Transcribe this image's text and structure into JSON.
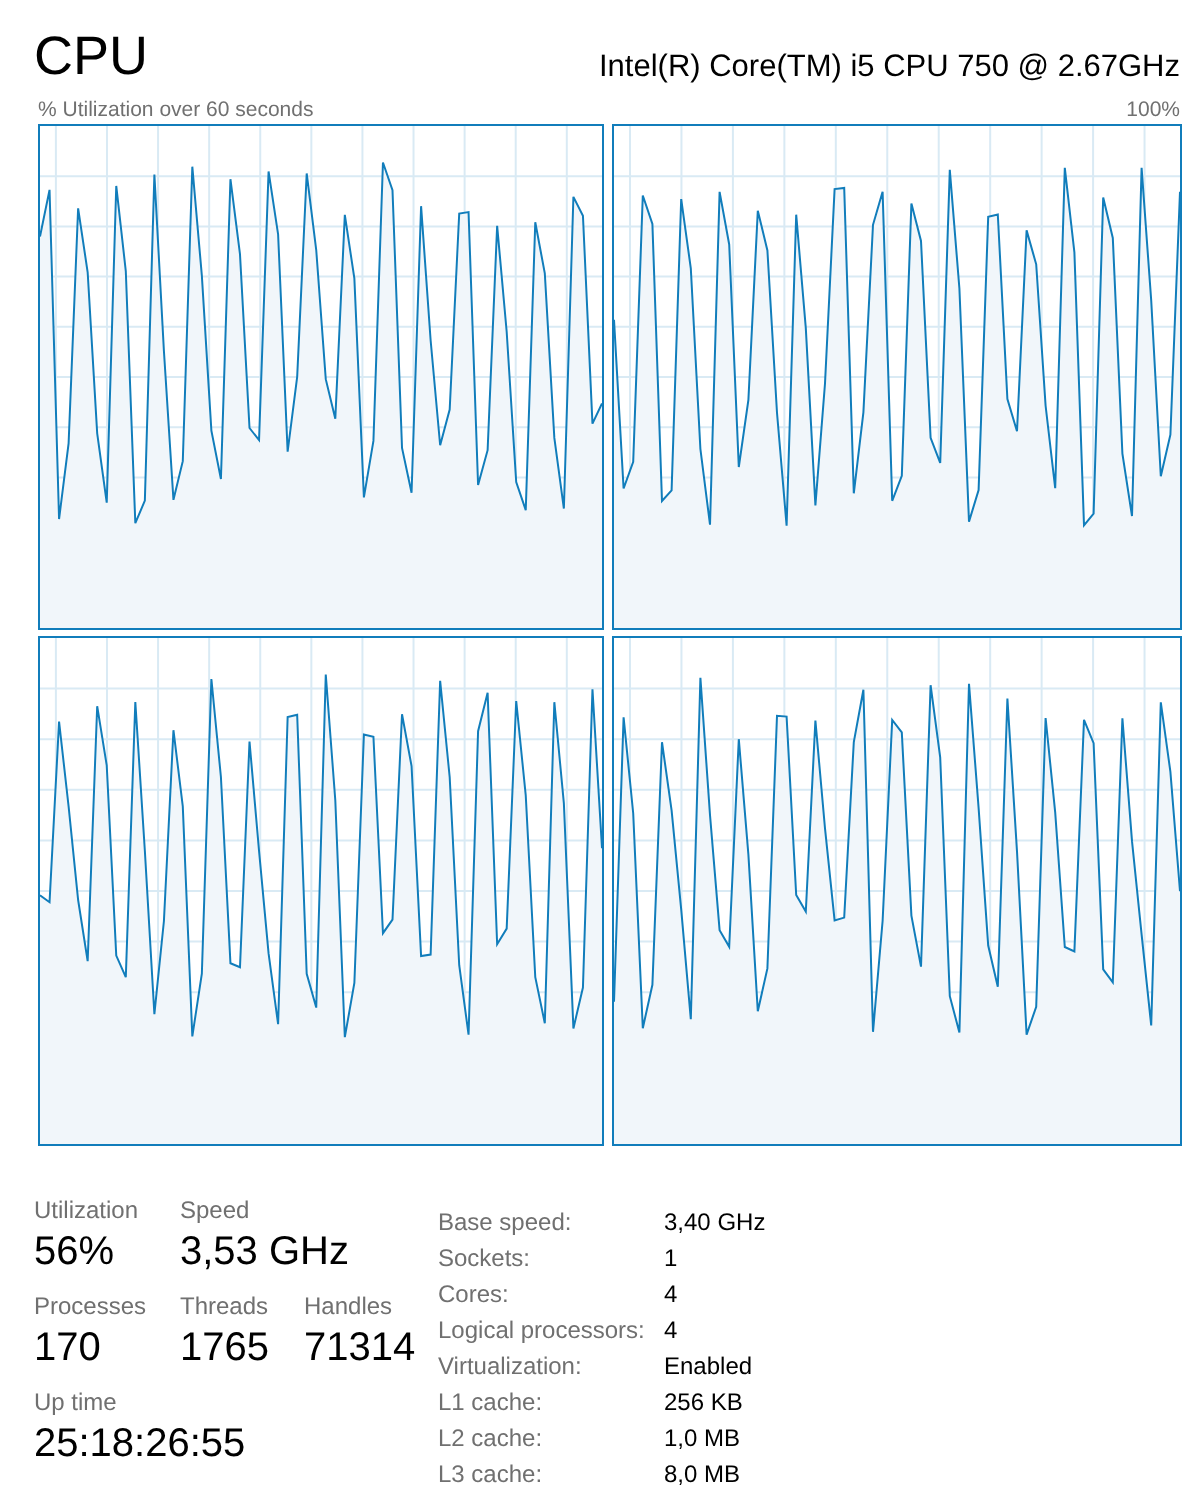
{
  "title": "CPU",
  "model": "Intel(R) Core(TM) i5 CPU 750 @ 2.67GHz",
  "graph_caption": "% Utilization over 60 seconds",
  "graph_max": "100%",
  "graphs": [
    {
      "kind": "sparkline"
    },
    {
      "kind": "sparkline"
    },
    {
      "kind": "sparkline"
    },
    {
      "kind": "sparkline"
    }
  ],
  "stats": [
    [
      {
        "label": "Utilization",
        "value": "56%"
      },
      {
        "label": "Speed",
        "value": "3,53 GHz"
      }
    ],
    [
      {
        "label": "Processes",
        "value": "170"
      },
      {
        "label": "Threads",
        "value": "1765"
      },
      {
        "label": "Handles",
        "value": "71314"
      }
    ],
    [
      {
        "label": "Up time",
        "value": "25:18:26:55"
      }
    ]
  ],
  "details": [
    {
      "label": "Base speed:",
      "value": "3,40 GHz"
    },
    {
      "label": "Sockets:",
      "value": "1"
    },
    {
      "label": "Cores:",
      "value": "4"
    },
    {
      "label": "Logical processors:",
      "value": "4"
    },
    {
      "label": "Virtualization:",
      "value": "Enabled"
    },
    {
      "label": "L1 cache:",
      "value": "256 KB"
    },
    {
      "label": "L2 cache:",
      "value": "1,0 MB"
    },
    {
      "label": "L3 cache:",
      "value": "8,0 MB"
    }
  ]
}
